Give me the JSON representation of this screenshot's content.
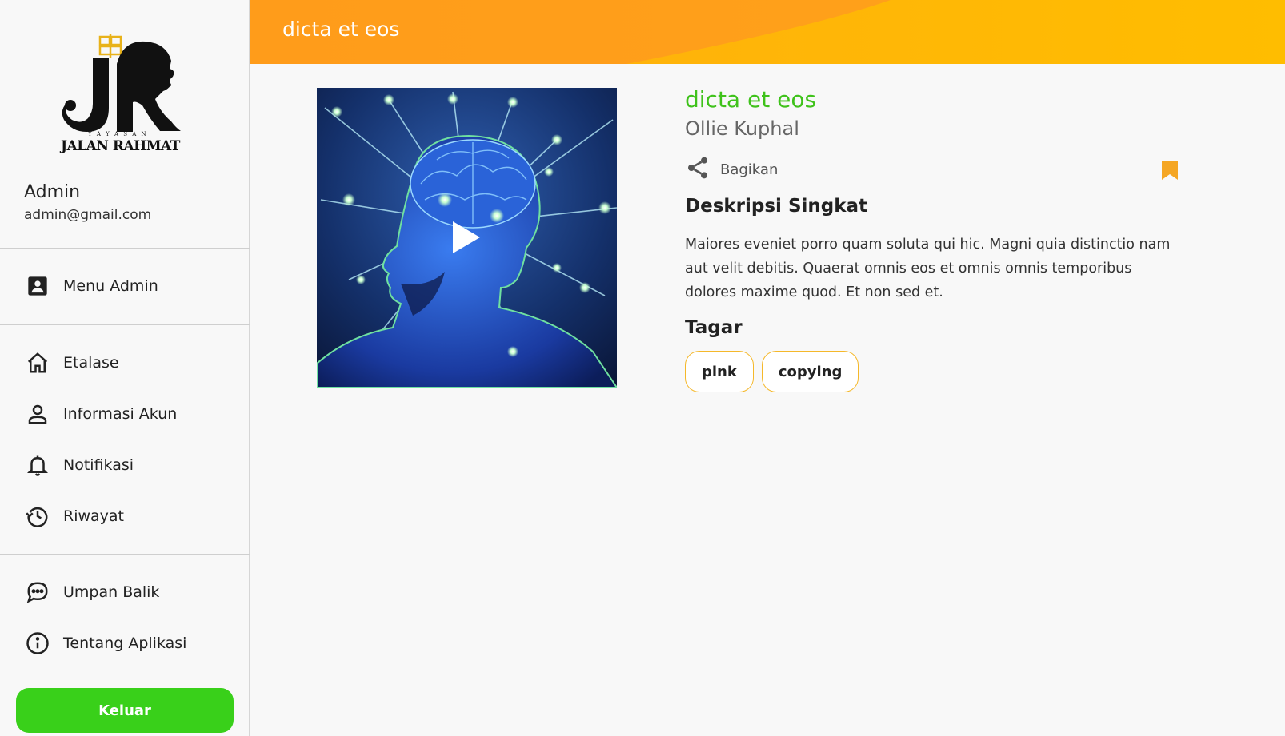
{
  "header": {
    "title": "dicta et eos"
  },
  "logo": {
    "line1": "Y A Y A S A N",
    "line2": "JALAN RAHMAT",
    "mark": "JR"
  },
  "profile": {
    "name": "Admin",
    "email": "admin@gmail.com"
  },
  "sidebar": {
    "admin_item": {
      "label": "Menu Admin",
      "icon": "admin-badge-icon"
    },
    "items": [
      {
        "label": "Etalase",
        "icon": "home-icon"
      },
      {
        "label": "Informasi Akun",
        "icon": "user-icon"
      },
      {
        "label": "Notifikasi",
        "icon": "bell-icon"
      },
      {
        "label": "Riwayat",
        "icon": "history-icon"
      }
    ],
    "footer_items": [
      {
        "label": "Umpan Balik",
        "icon": "chat-icon"
      },
      {
        "label": "Tentang Aplikasi",
        "icon": "info-icon"
      }
    ],
    "logout_label": "Keluar"
  },
  "content": {
    "title": "dicta et eos",
    "author": "Ollie Kuphal",
    "share_label": "Bagikan",
    "description_heading": "Deskripsi Singkat",
    "description": "Maiores eveniet porro quam soluta qui hic. Magni quia distinctio nam aut velit debitis. Quaerat omnis eos et omnis omnis temporibus dolores maxime quod. Et non sed et.",
    "tags_heading": "Tagar",
    "tags": [
      "pink",
      "copying"
    ]
  },
  "colors": {
    "accent_green": "#39d01a",
    "title_green": "#3fc21b",
    "header_orange": "#ff9c1a",
    "header_yellow": "#ffbb00",
    "bookmark_orange": "#f5a623",
    "tag_border": "#f5b82a"
  }
}
